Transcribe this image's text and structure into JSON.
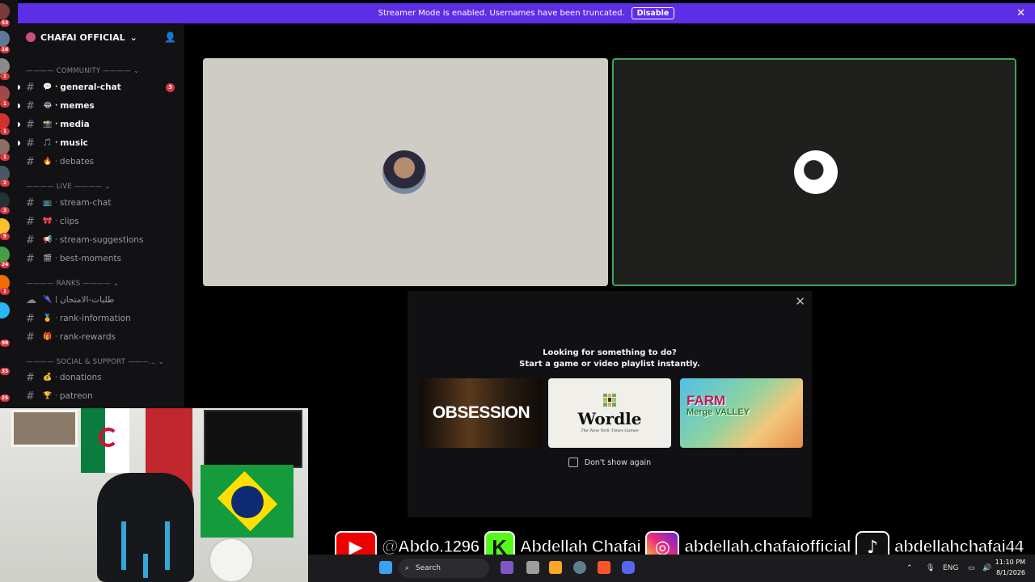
{
  "banner": {
    "message": "Streamer Mode is enabled. Usernames have been truncated.",
    "action_label": "Disable",
    "close_glyph": "✕"
  },
  "server": {
    "name": "CHAFAI OFFICIAL",
    "chevron": "⌄",
    "invite_glyph": "👤"
  },
  "rail": {
    "badges": [
      "53",
      "16",
      "1",
      "1",
      "1",
      "1",
      "2",
      "3",
      "9",
      "24",
      "1",
      "98",
      "33",
      "25"
    ]
  },
  "categories": [
    {
      "label": "———— COMMUNITY ———— ⌄"
    },
    {
      "label": "———— LIVE ———— ⌄"
    },
    {
      "label": "———— RANKS ———— ⌄"
    },
    {
      "label": "———— SOCIAL & SUPPORT ———... ⌄"
    }
  ],
  "channels": [
    {
      "name": "general-chat",
      "emoji": "💬",
      "unread": true,
      "mentions": "3"
    },
    {
      "name": "memes",
      "emoji": "😂",
      "unread": true,
      "mentions": ""
    },
    {
      "name": "media",
      "emoji": "📸",
      "unread": true,
      "mentions": ""
    },
    {
      "name": "music",
      "emoji": "🎵",
      "unread": true,
      "mentions": ""
    },
    {
      "name": "debates",
      "emoji": "🔥",
      "unread": false,
      "mentions": ""
    },
    {
      "name": "stream-chat",
      "emoji": "📺",
      "unread": false,
      "mentions": ""
    },
    {
      "name": "clips",
      "emoji": "🎀",
      "unread": false,
      "mentions": ""
    },
    {
      "name": "stream-suggestions",
      "emoji": "📢",
      "unread": false,
      "mentions": ""
    },
    {
      "name": "best-moments",
      "emoji": "🎬",
      "unread": false,
      "mentions": ""
    },
    {
      "name": "طلبات-الامتحان",
      "emoji": "🌂",
      "unread": false,
      "mentions": ""
    },
    {
      "name": "rank-information",
      "emoji": "🏅",
      "unread": false,
      "mentions": ""
    },
    {
      "name": "rank-rewards",
      "emoji": "🎁",
      "unread": false,
      "mentions": ""
    },
    {
      "name": "donations",
      "emoji": "💰",
      "unread": false,
      "mentions": ""
    },
    {
      "name": "patreon",
      "emoji": "🏆",
      "unread": false,
      "mentions": ""
    }
  ],
  "activity_modal": {
    "close_glyph": "✕",
    "title_line1": "Looking for something to do?",
    "title_line2": "Start a game or video playlist instantly.",
    "cards": [
      {
        "title": "OBSESSION"
      },
      {
        "title": "Wordle",
        "subtitle": "The New York Times Games"
      },
      {
        "title": "FARM",
        "subtitle": "Merge VALLEY"
      }
    ],
    "dont_show_label": "Don't show again"
  },
  "socials": [
    {
      "icon": "youtube-icon",
      "glyph": "▶",
      "handle": "@Abdo.1296"
    },
    {
      "icon": "kick-icon",
      "glyph": "K",
      "handle": "Abdellah Chafai"
    },
    {
      "icon": "instagram-icon",
      "glyph": "◎",
      "handle": "abdellah.chafaiofficial"
    },
    {
      "icon": "tiktok-icon",
      "glyph": "♪",
      "handle": "abdellahchafai44"
    }
  ],
  "taskbar": {
    "search_label": "Search",
    "language": "ENG",
    "time": "11:10 PM",
    "date": "8/1/2026"
  },
  "colors": {
    "banner": "#5c2ee6",
    "speaking_border": "#3ba55d",
    "mention": "#da373c"
  }
}
